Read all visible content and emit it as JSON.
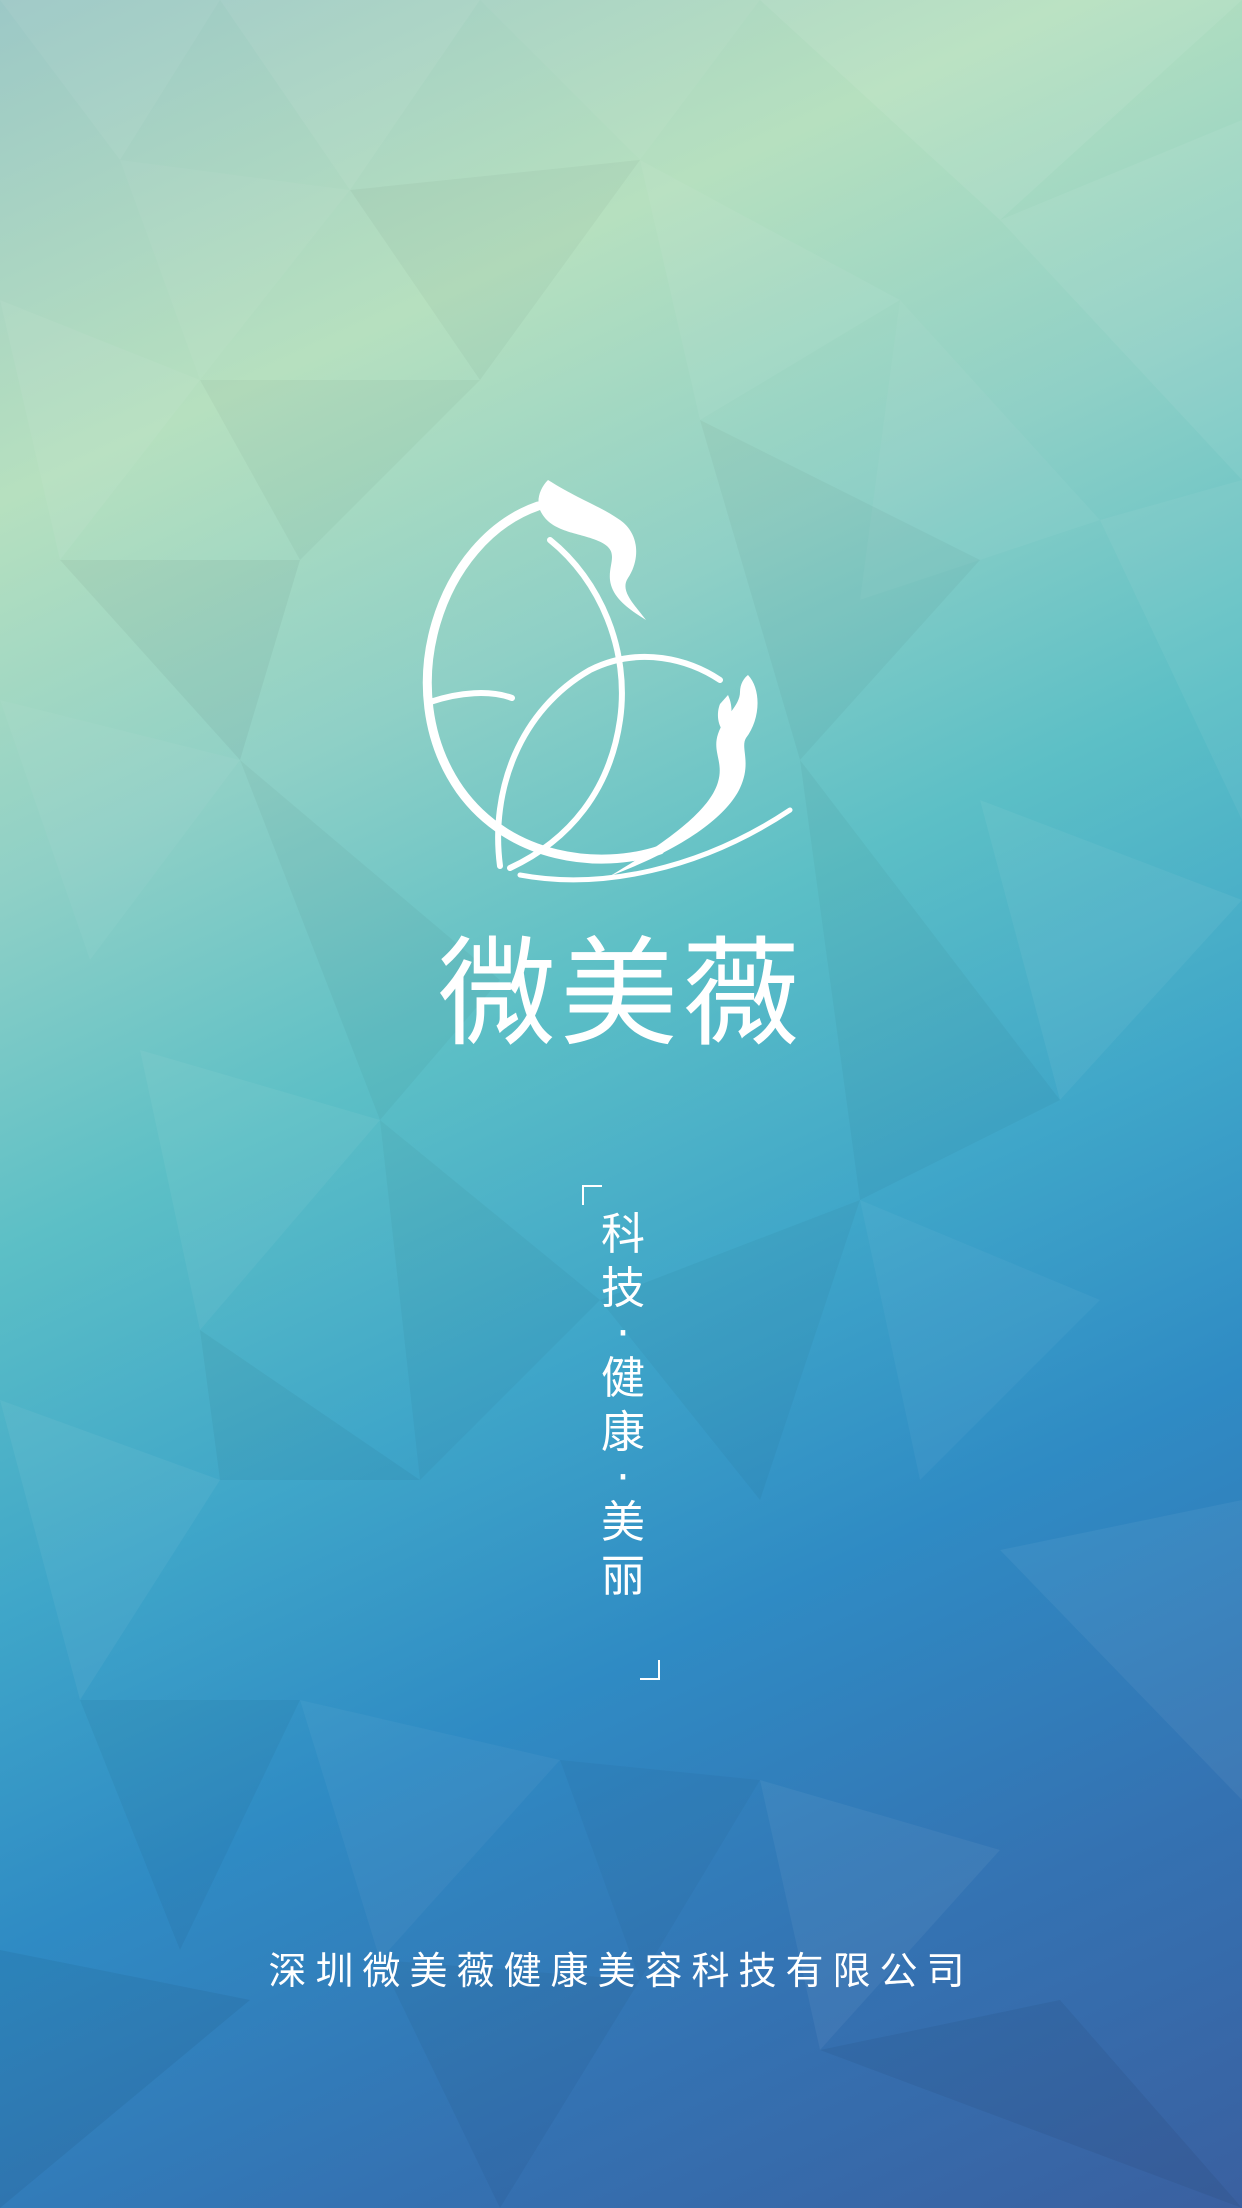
{
  "app": {
    "brand_name": "微美薇",
    "tagline": "科技·健康·美丽",
    "tagline_chars": [
      "科",
      "技",
      "·",
      "健",
      "康",
      "·",
      "美",
      "丽"
    ],
    "company": "深圳微美薇健康美容科技有限公司",
    "logo_icon": "butterfly-icon",
    "colors": {
      "text": "#ffffff",
      "top": "#b6e0bf",
      "middle": "#3fa6c9",
      "bottom": "#3a60a0"
    }
  }
}
